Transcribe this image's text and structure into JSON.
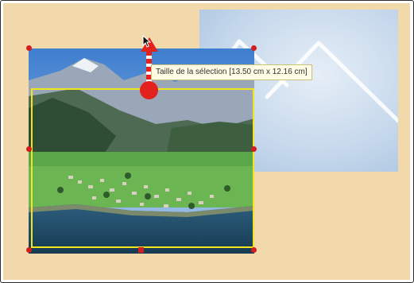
{
  "tooltip": {
    "text": "Taille de la sélection [13.50 cm x 12.16 cm]"
  },
  "icons": {
    "resize_arrow": "arrow-up-icon",
    "drag_handle": "circle-handle-icon",
    "cursor": "mouse-cursor-icon"
  },
  "colors": {
    "canvas_bg": "#f1d9ac",
    "selection_border": "#f2e51c",
    "handle": "#d21e1e",
    "drag_indicator": "#e3211d"
  }
}
